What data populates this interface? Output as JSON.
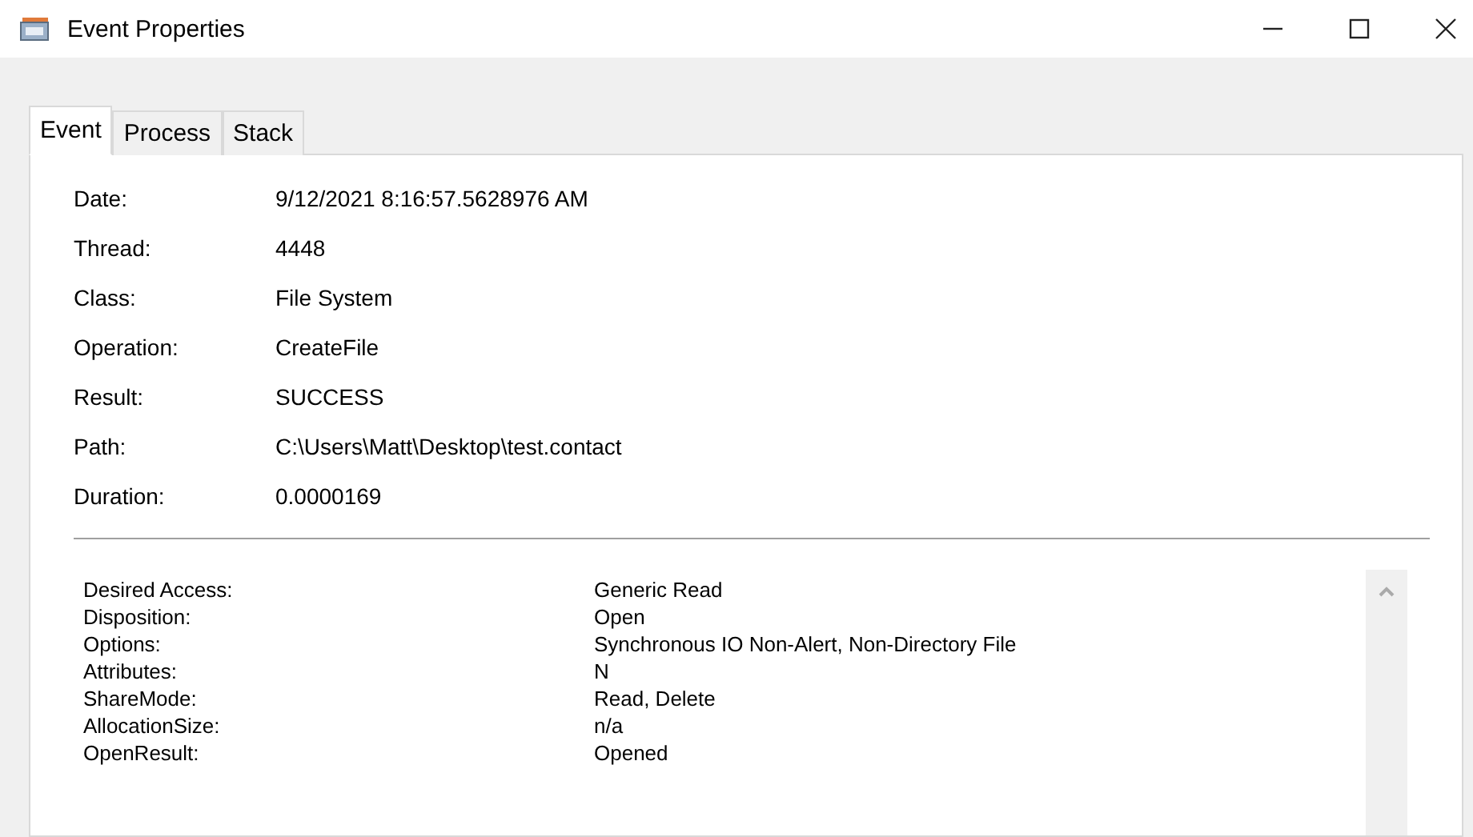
{
  "window": {
    "title": "Event Properties"
  },
  "tabs": [
    {
      "label": "Event",
      "selected": true
    },
    {
      "label": "Process",
      "selected": false
    },
    {
      "label": "Stack",
      "selected": false
    }
  ],
  "properties": [
    {
      "label": "Date:",
      "value": "9/12/2021 8:16:57.5628976 AM"
    },
    {
      "label": "Thread:",
      "value": "4448"
    },
    {
      "label": "Class:",
      "value": "File System"
    },
    {
      "label": "Operation:",
      "value": "CreateFile"
    },
    {
      "label": "Result:",
      "value": "SUCCESS"
    },
    {
      "label": "Path:",
      "value": "C:\\Users\\Matt\\Desktop\\test.contact"
    },
    {
      "label": "Duration:",
      "value": "0.0000169"
    }
  ],
  "details": [
    {
      "name": "Desired Access:",
      "value": "Generic Read"
    },
    {
      "name": "Disposition:",
      "value": "Open"
    },
    {
      "name": "Options:",
      "value": "Synchronous IO Non-Alert, Non-Directory File"
    },
    {
      "name": "Attributes:",
      "value": "N"
    },
    {
      "name": "ShareMode:",
      "value": "Read, Delete"
    },
    {
      "name": "AllocationSize:",
      "value": "n/a"
    },
    {
      "name": "OpenResult:",
      "value": "Opened"
    }
  ]
}
